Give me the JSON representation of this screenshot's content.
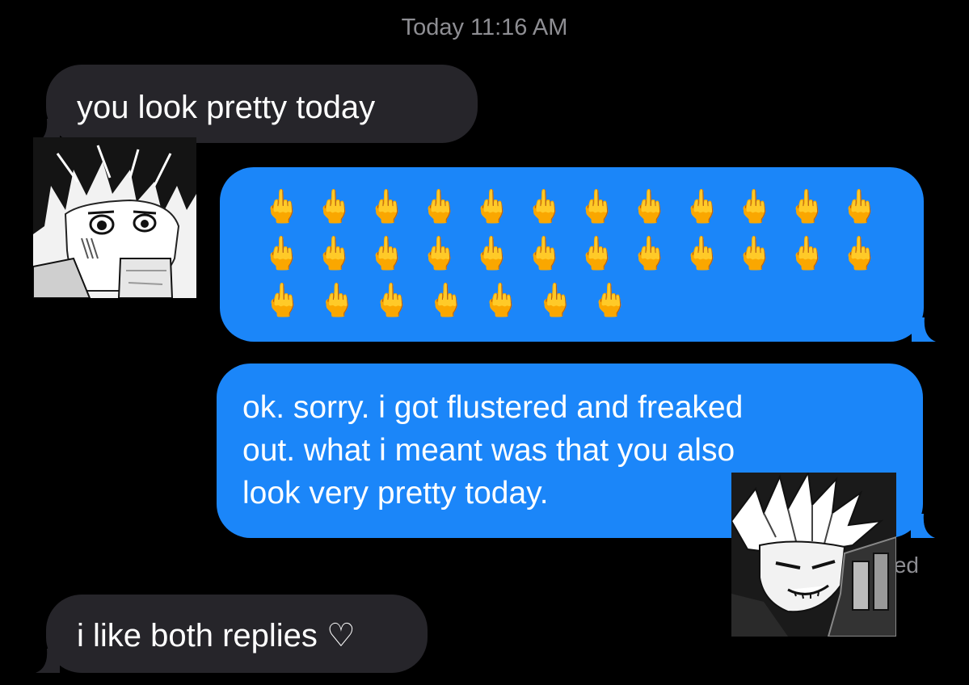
{
  "header": {
    "timestamp": "Today 11:16 AM"
  },
  "messages": [
    {
      "direction": "received",
      "text": "you look pretty today"
    },
    {
      "direction": "sent",
      "emoji": "🖕",
      "emoji_rows": [
        12,
        12,
        7
      ]
    },
    {
      "direction": "sent",
      "lines": [
        "ok. sorry. i got flustered and freaked",
        "out. what i meant was that you also",
        "look very pretty today."
      ]
    },
    {
      "direction": "received",
      "text": "i like both replies ♡"
    }
  ],
  "status": {
    "delivered_fragment": "ed"
  },
  "stickers": [
    {
      "name": "manga-avatar-curly-hair"
    },
    {
      "name": "manga-avatar-spiky-hair"
    }
  ],
  "colors": {
    "background": "#000000",
    "received_bubble": "#26252a",
    "sent_bubble": "#1b86f9",
    "timestamp_text": "#8e8e93"
  }
}
